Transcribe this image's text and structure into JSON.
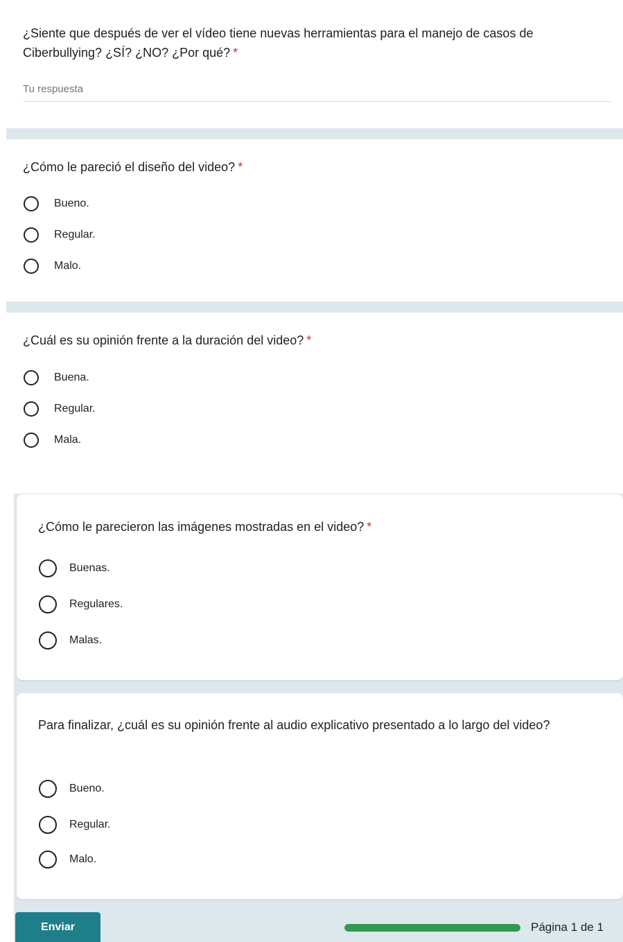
{
  "questions": [
    {
      "title": "¿Siente que después de ver el vídeo tiene nuevas herramientas para el manejo de casos de Ciberbullying? ¿SÍ? ¿NO? ¿Por qué?",
      "required": "*",
      "type": "short_answer",
      "placeholder": "Tu respuesta"
    },
    {
      "title": "¿Cómo le pareció el diseño del video?",
      "required": "*",
      "options": [
        "Bueno.",
        "Regular.",
        "Malo."
      ]
    },
    {
      "title": "¿Cuál es su opinión frente a la duración del video?",
      "required": "*",
      "options": [
        "Buena.",
        "Regular.",
        "Mala."
      ]
    },
    {
      "title": "¿Cómo le parecieron las imágenes mostradas en el video?",
      "required": "*",
      "options": [
        "Buenas.",
        "Regulares.",
        "Malas."
      ]
    },
    {
      "title": "Para finalizar, ¿cuál es su opinión frente al audio explicativo presentado a lo largo del video?",
      "options": [
        "Bueno.",
        "Regular.",
        "Malo."
      ]
    }
  ],
  "footer": {
    "submit_label": "Enviar",
    "page_indicator": "Página 1 de 1",
    "progress": 1.0
  },
  "colors": {
    "accent": "#1e7f8a",
    "progress": "#2e9a52",
    "required": "#d93025",
    "band": "#dde8ec"
  }
}
